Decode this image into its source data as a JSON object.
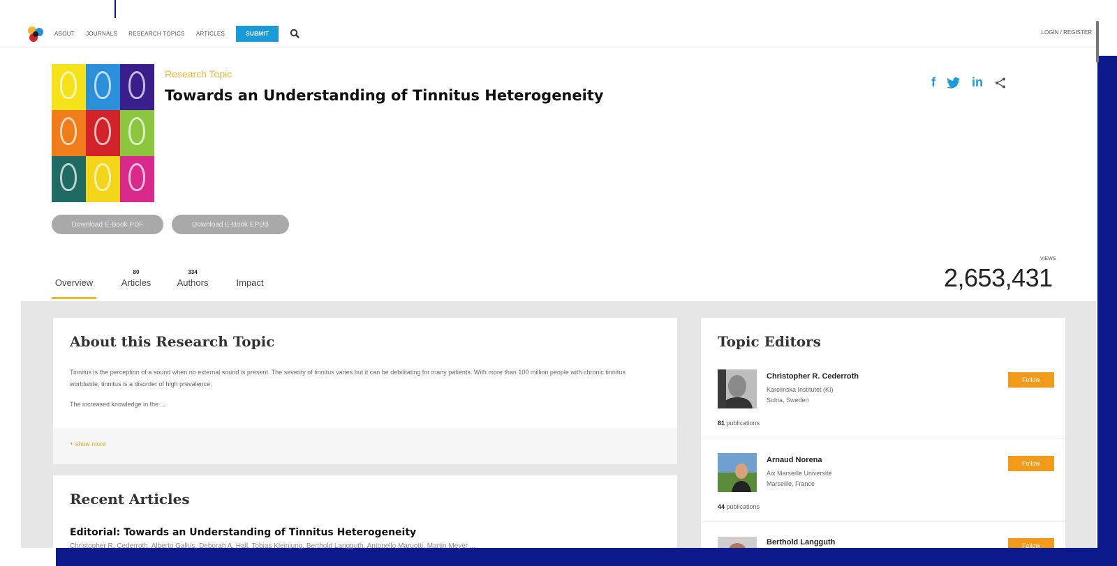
{
  "nav": {
    "items": [
      "ABOUT",
      "JOURNALS",
      "RESEARCH TOPICS",
      "ARTICLES"
    ],
    "submit_label": "SUBMIT",
    "login_label": "LOGIN / REGISTER"
  },
  "header": {
    "label": "Research Topic",
    "title": "Towards an Understanding of Tinnitus Heterogeneity",
    "download_pdf": "Download E-Book PDF",
    "download_epub": "Download E-Book EPUB",
    "cover_colors": [
      "#f5e21a",
      "#2c8fd9",
      "#3a1f8c",
      "#f07d1a",
      "#d2232a",
      "#8cc63e",
      "#1f6b64",
      "#f5d51a",
      "#d9298a"
    ]
  },
  "social": {
    "icons": [
      "facebook-icon",
      "twitter-icon",
      "linkedin-icon",
      "share-icon"
    ],
    "labels": [
      "f",
      "🐦",
      "in",
      "<"
    ]
  },
  "tabs": [
    {
      "label": "Overview",
      "count": ""
    },
    {
      "label": "Articles",
      "count": "80"
    },
    {
      "label": "Authors",
      "count": "334"
    },
    {
      "label": "Impact",
      "count": ""
    }
  ],
  "views": {
    "label": "VIEWS",
    "value": "2,653,431"
  },
  "about": {
    "title": "About this Research Topic",
    "text1": "Tinnitus is the perception of a sound when no external sound is present. The severity of tinnitus varies but it can be debilitating for many patients. With more than 100 million people with chronic tinnitus worldwide, tinnitus is a disorder of high prevalence.",
    "text2": "The increased knowledge in the ...",
    "show_more": "+ show more"
  },
  "recent": {
    "title": "Recent Articles",
    "article_title": "Editorial: Towards an Understanding of Tinnitus Heterogeneity",
    "article_authors": "Christopher R. Cederroth, Alberto Gallus, Deborah A. Hall, Tobias Kleinjung, Berthold Langguth, Antonello Maruotti, Martin Meyer ..."
  },
  "editors": {
    "title": "Topic Editors",
    "follow_label": "Follow",
    "list": [
      {
        "name": "Christopher R. Cederroth",
        "aff1": "Karolinska Institutet (KI)",
        "aff2": "Solna, Sweden",
        "pubs": "81",
        "pubs_label": "publications"
      },
      {
        "name": "Arnaud Norena",
        "aff1": "Aix Marseille Université",
        "aff2": "Marseille, France",
        "pubs": "44",
        "pubs_label": "publications"
      },
      {
        "name": "Berthold Langguth",
        "aff1": "",
        "aff2": "",
        "pubs": "",
        "pubs_label": ""
      }
    ]
  }
}
